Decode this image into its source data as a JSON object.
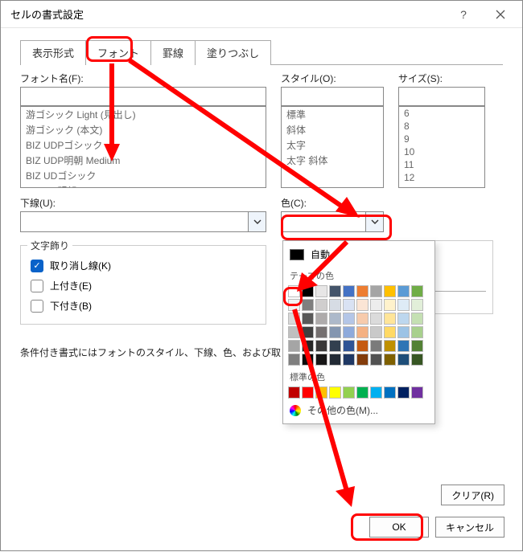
{
  "dialog": {
    "title": "セルの書式設定"
  },
  "tabs": {
    "format": "表示形式",
    "font": "フォント",
    "border": "罫線",
    "fill": "塗りつぶし"
  },
  "labels": {
    "fontName": "フォント名(F):",
    "style": "スタイル(O):",
    "size": "サイズ(S):",
    "underline": "下線(U):",
    "color": "色(C):",
    "decor": "文字飾り",
    "strike": "取り消し線(K)",
    "super": "上付き(E)",
    "sub": "下付き(B)",
    "note": "条件付き書式にはフォントのスタイル、下線、色、および取",
    "clear": "クリア(R)",
    "ok": "OK",
    "cancel": "キャンセル"
  },
  "fontList": [
    "游ゴシック Light (見出し)",
    "游ゴシック (本文)",
    "BIZ UDPゴシック",
    "BIZ UDP明朝 Medium",
    "BIZ UDゴシック",
    "BIZ UD明朝 Medium"
  ],
  "styleList": [
    "標準",
    "斜体",
    "太字",
    "太字 斜体"
  ],
  "sizeList": [
    "6",
    "8",
    "9",
    "10",
    "11",
    "12"
  ],
  "popup": {
    "auto": "自動",
    "theme": "テーマの色",
    "std": "標準の色",
    "more": "その他の色(M)..."
  },
  "themeColors": [
    [
      "#ffffff",
      "#000000",
      "#e7e6e6",
      "#44546a",
      "#4472c4",
      "#ed7d31",
      "#a5a5a5",
      "#ffc000",
      "#5b9bd5",
      "#70ad47"
    ],
    [
      "#f2f2f2",
      "#7f7f7f",
      "#d0cece",
      "#d6dce4",
      "#d9e2f3",
      "#fbe5d5",
      "#ededed",
      "#fff2cc",
      "#deebf6",
      "#e2efd9"
    ],
    [
      "#d8d8d8",
      "#595959",
      "#aeabab",
      "#adb9ca",
      "#b4c6e7",
      "#f7cbac",
      "#dbdbdb",
      "#ffe599",
      "#bdd7ee",
      "#c5e0b3"
    ],
    [
      "#bfbfbf",
      "#3f3f3f",
      "#757070",
      "#8496b0",
      "#8eaadb",
      "#f4b183",
      "#c9c9c9",
      "#ffd965",
      "#9cc3e5",
      "#a8d08d"
    ],
    [
      "#a5a5a5",
      "#262626",
      "#3a3838",
      "#323f4f",
      "#2f5496",
      "#c55a11",
      "#7b7b7b",
      "#bf9000",
      "#2e75b5",
      "#538135"
    ],
    [
      "#7f7f7f",
      "#0c0c0c",
      "#171616",
      "#222a35",
      "#1f3864",
      "#833c0b",
      "#525252",
      "#7f6000",
      "#1e4e79",
      "#375623"
    ]
  ],
  "stdColors": [
    "#c00000",
    "#ff0000",
    "#ffc000",
    "#ffff00",
    "#92d050",
    "#00b050",
    "#00b0f0",
    "#0070c0",
    "#002060",
    "#7030a0"
  ]
}
